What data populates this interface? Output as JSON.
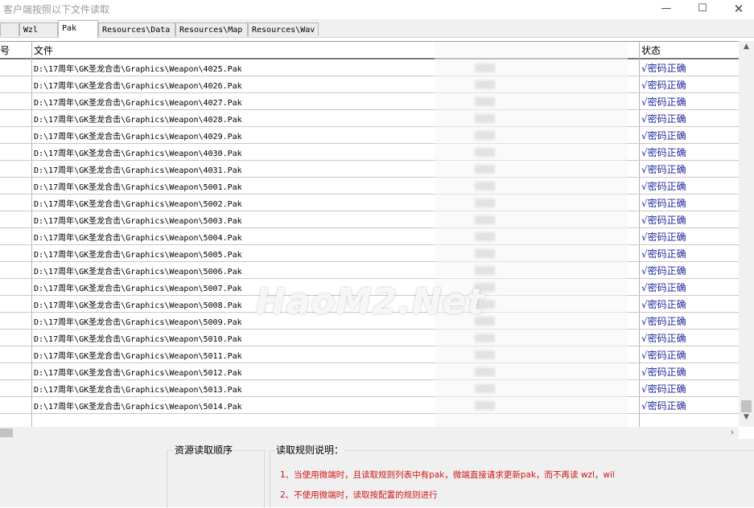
{
  "window": {
    "title": "客户端按照以下文件读取",
    "min_glyph": "—",
    "max_glyph": "☐",
    "close_glyph": "✕"
  },
  "tabs": [
    {
      "label": "",
      "active": false
    },
    {
      "label": "Wzl",
      "active": false
    },
    {
      "label": "Pak",
      "active": true
    },
    {
      "label": "Resources\\Data",
      "active": false
    },
    {
      "label": "Resources\\Map",
      "active": false
    },
    {
      "label": "Resources\\Wav",
      "active": false
    }
  ],
  "table": {
    "headers": {
      "index": "号",
      "file": "文件",
      "status": "状态"
    },
    "rows": [
      {
        "file": "D:\\17周年\\GK圣龙合击\\Graphics\\Weapon\\4025.Pak",
        "status": "√密码正确"
      },
      {
        "file": "D:\\17周年\\GK圣龙合击\\Graphics\\Weapon\\4026.Pak",
        "status": "√密码正确"
      },
      {
        "file": "D:\\17周年\\GK圣龙合击\\Graphics\\Weapon\\4027.Pak",
        "status": "√密码正确"
      },
      {
        "file": "D:\\17周年\\GK圣龙合击\\Graphics\\Weapon\\4028.Pak",
        "status": "√密码正确"
      },
      {
        "file": "D:\\17周年\\GK圣龙合击\\Graphics\\Weapon\\4029.Pak",
        "status": "√密码正确"
      },
      {
        "file": "D:\\17周年\\GK圣龙合击\\Graphics\\Weapon\\4030.Pak",
        "status": "√密码正确"
      },
      {
        "file": "D:\\17周年\\GK圣龙合击\\Graphics\\Weapon\\4031.Pak",
        "status": "√密码正确"
      },
      {
        "file": "D:\\17周年\\GK圣龙合击\\Graphics\\Weapon\\5001.Pak",
        "status": "√密码正确"
      },
      {
        "file": "D:\\17周年\\GK圣龙合击\\Graphics\\Weapon\\5002.Pak",
        "status": "√密码正确"
      },
      {
        "file": "D:\\17周年\\GK圣龙合击\\Graphics\\Weapon\\5003.Pak",
        "status": "√密码正确"
      },
      {
        "file": "D:\\17周年\\GK圣龙合击\\Graphics\\Weapon\\5004.Pak",
        "status": "√密码正确"
      },
      {
        "file": "D:\\17周年\\GK圣龙合击\\Graphics\\Weapon\\5005.Pak",
        "status": "√密码正确"
      },
      {
        "file": "D:\\17周年\\GK圣龙合击\\Graphics\\Weapon\\5006.Pak",
        "status": "√密码正确"
      },
      {
        "file": "D:\\17周年\\GK圣龙合击\\Graphics\\Weapon\\5007.Pak",
        "status": "√密码正确"
      },
      {
        "file": "D:\\17周年\\GK圣龙合击\\Graphics\\Weapon\\5008.Pak",
        "status": "√密码正确"
      },
      {
        "file": "D:\\17周年\\GK圣龙合击\\Graphics\\Weapon\\5009.Pak",
        "status": "√密码正确"
      },
      {
        "file": "D:\\17周年\\GK圣龙合击\\Graphics\\Weapon\\5010.Pak",
        "status": "√密码正确"
      },
      {
        "file": "D:\\17周年\\GK圣龙合击\\Graphics\\Weapon\\5011.Pak",
        "status": "√密码正确"
      },
      {
        "file": "D:\\17周年\\GK圣龙合击\\Graphics\\Weapon\\5012.Pak",
        "status": "√密码正确"
      },
      {
        "file": "D:\\17周年\\GK圣龙合击\\Graphics\\Weapon\\5013.Pak",
        "status": "√密码正确"
      },
      {
        "file": "D:\\17周年\\GK圣龙合击\\Graphics\\Weapon\\5014.Pak",
        "status": "√密码正确"
      }
    ]
  },
  "watermark": "HaoM2.Net",
  "bottom": {
    "order_group_label": "资源读取顺序",
    "rules_group_label": "读取规则说明：",
    "rules": [
      "1、当使用微端时，且读取规则列表中有pak，微端直接请求更新pak，而不再读 wzl，wil",
      "2、不使用微端时，读取按配置的规则进行"
    ]
  },
  "colors": {
    "status_text": "#1f2a9c",
    "rule_text": "#d21414",
    "title_text": "#999999"
  },
  "icons": {
    "scroll_up": "▲",
    "scroll_down": "▼",
    "scroll_right": "›"
  }
}
